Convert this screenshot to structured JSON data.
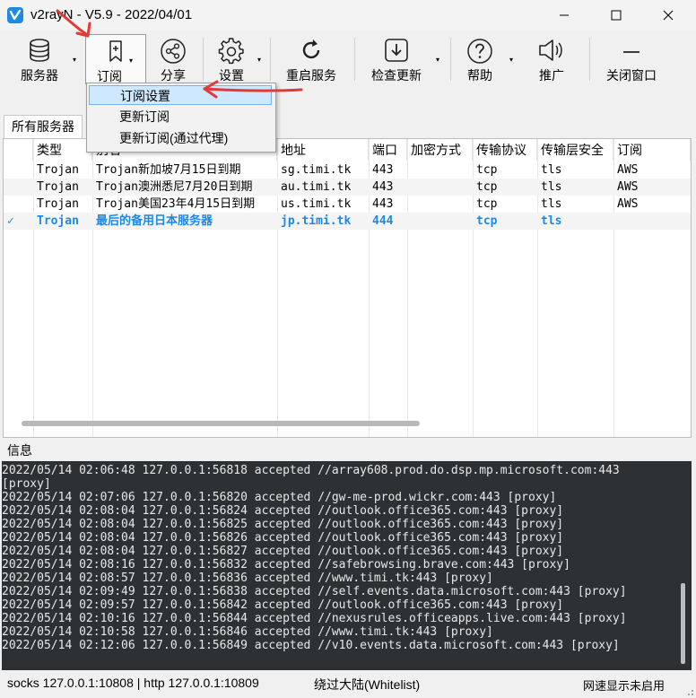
{
  "window": {
    "title": "v2rayN - V5.9 - 2022/04/01",
    "minimize": "minimize",
    "maximize": "maximize",
    "close": "close"
  },
  "toolbar": {
    "servers": "服务器",
    "subscription": "订阅",
    "share": "分享",
    "settings": "设置",
    "restart": "重启服务",
    "check_update": "检查更新",
    "help": "帮助",
    "promote": "推广",
    "close_window": "关闭窗口"
  },
  "subscription_menu": {
    "items": [
      "订阅设置",
      "更新订阅",
      "更新订阅(通过代理)"
    ]
  },
  "tabs": {
    "all_servers": "所有服务器"
  },
  "server_list": {
    "columns": [
      "类型",
      "别名",
      "地址",
      "端口",
      "加密方式",
      "传输协议",
      "传输层安全",
      "订阅"
    ],
    "rows": [
      {
        "check": "",
        "type": "Trojan",
        "alias": "Trojan新加坡7月15日到期",
        "address": "sg.timi.tk",
        "port": "443",
        "encryption": "",
        "network": "tcp",
        "tls": "tls",
        "sub": "AWS"
      },
      {
        "check": "",
        "type": "Trojan",
        "alias": "Trojan澳洲悉尼7月20日到期",
        "address": "au.timi.tk",
        "port": "443",
        "encryption": "",
        "network": "tcp",
        "tls": "tls",
        "sub": "AWS"
      },
      {
        "check": "",
        "type": "Trojan",
        "alias": "Trojan美国23年4月15日到期",
        "address": "us.timi.tk",
        "port": "443",
        "encryption": "",
        "network": "tcp",
        "tls": "tls",
        "sub": "AWS"
      },
      {
        "check": "✓",
        "type": "Trojan",
        "alias": "最后的备用日本服务器",
        "address": "jp.timi.tk",
        "port": "444",
        "encryption": "",
        "network": "tcp",
        "tls": "tls",
        "sub": ""
      }
    ]
  },
  "info": {
    "label": "信息",
    "log": [
      "2022/05/14 02:06:48 127.0.0.1:56818 accepted //array608.prod.do.dsp.mp.microsoft.com:443",
      "[proxy]",
      "2022/05/14 02:07:06 127.0.0.1:56820 accepted //gw-me-prod.wickr.com:443 [proxy]",
      "2022/05/14 02:08:04 127.0.0.1:56824 accepted //outlook.office365.com:443 [proxy]",
      "2022/05/14 02:08:04 127.0.0.1:56825 accepted //outlook.office365.com:443 [proxy]",
      "2022/05/14 02:08:04 127.0.0.1:56826 accepted //outlook.office365.com:443 [proxy]",
      "2022/05/14 02:08:04 127.0.0.1:56827 accepted //outlook.office365.com:443 [proxy]",
      "2022/05/14 02:08:16 127.0.0.1:56832 accepted //safebrowsing.brave.com:443 [proxy]",
      "2022/05/14 02:08:57 127.0.0.1:56836 accepted //www.timi.tk:443 [proxy]",
      "2022/05/14 02:09:49 127.0.0.1:56838 accepted //self.events.data.microsoft.com:443 [proxy]",
      "2022/05/14 02:09:57 127.0.0.1:56842 accepted //outlook.office365.com:443 [proxy]",
      "2022/05/14 02:10:16 127.0.0.1:56844 accepted //nexusrules.officeapps.live.com:443 [proxy]",
      "2022/05/14 02:10:58 127.0.0.1:56846 accepted //www.timi.tk:443 [proxy]",
      "2022/05/14 02:12:06 127.0.0.1:56849 accepted //v10.events.data.microsoft.com:443 [proxy]"
    ]
  },
  "status": {
    "proxy": "socks 127.0.0.1:10808 | http 127.0.0.1:10809",
    "routing": "绕过大陆(Whitelist)",
    "speed": "网速显示未启用"
  },
  "colors": {
    "accent": "#1e88e5",
    "annotation": "#e53935",
    "console_bg": "#2d3133"
  }
}
